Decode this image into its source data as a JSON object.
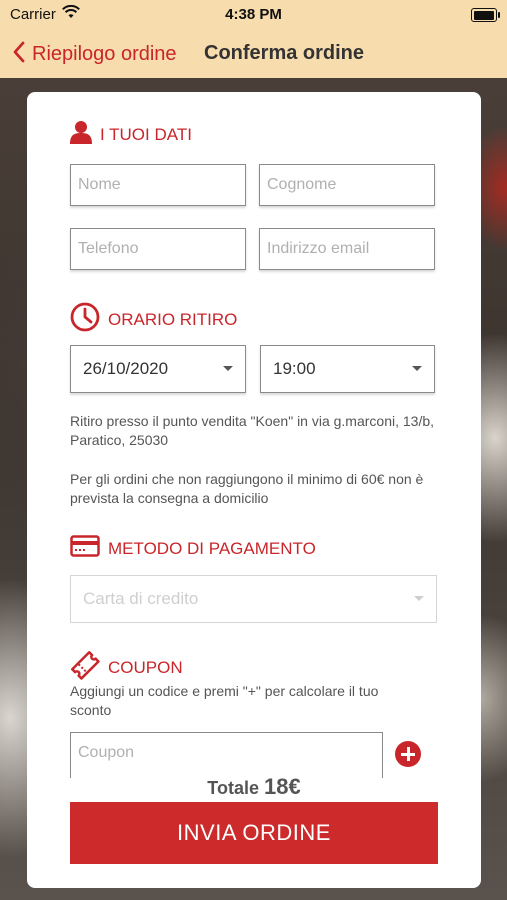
{
  "status_bar": {
    "carrier": "Carrier",
    "time": "4:38 PM"
  },
  "nav": {
    "back_label": "Riepilogo ordine",
    "title": "Conferma ordine"
  },
  "section_dati": {
    "title": "I TUOI DATI",
    "nome_placeholder": "Nome",
    "cognome_placeholder": "Cognome",
    "telefono_placeholder": "Telefono",
    "email_placeholder": "Indirizzo email"
  },
  "section_orario": {
    "title": "ORARIO RITIRO",
    "date_value": "26/10/2020",
    "time_value": "19:00",
    "pickup_note": "Ritiro presso il punto vendita \"Koen\" in via g.marconi, 13/b, Paratico, 25030",
    "minimum_note": "Per gli ordini che non raggiungono il minimo di 60€ non è prevista la consegna a domicilio"
  },
  "section_pagamento": {
    "title": "METODO DI PAGAMENTO",
    "method_value": "Carta di credito"
  },
  "section_coupon": {
    "title": "COUPON",
    "hint": "Aggiungi un codice e premi \"+\" per calcolare il tuo sconto",
    "coupon_placeholder": "Coupon"
  },
  "total": {
    "label": "Totale",
    "amount": "18€"
  },
  "submit_label": "INVIA ORDINE",
  "colors": {
    "accent": "#c8262a",
    "nav_background": "#f7dcae"
  },
  "icons": [
    "wifi-icon",
    "battery-icon",
    "chevron-left-icon",
    "person-icon",
    "clock-icon",
    "credit-card-icon",
    "ticket-icon",
    "caret-down-icon",
    "plus-circle-icon"
  ]
}
